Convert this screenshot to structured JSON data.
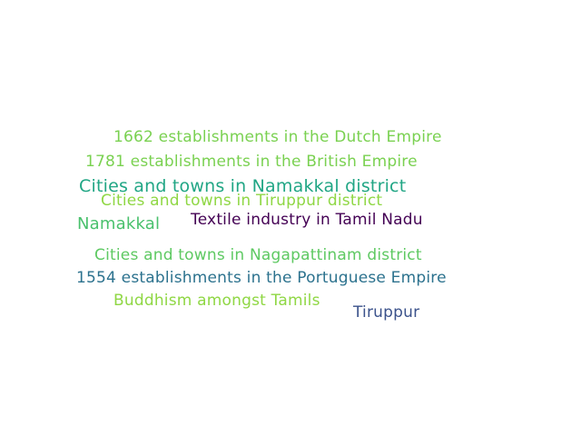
{
  "words": [
    {
      "text": "1662 establishments in the Dutch Empire",
      "color": "#7ad151"
    },
    {
      "text": "1781 establishments in the British Empire",
      "color": "#7ad151"
    },
    {
      "text": "Cities and towns in Namakkal district",
      "color": "#21a685"
    },
    {
      "text": "Cities and towns in Tiruppur district",
      "color": "#8fd744"
    },
    {
      "text": "Namakkal",
      "color": "#4ac16d"
    },
    {
      "text": "Textile industry in Tamil Nadu",
      "color": "#440154"
    },
    {
      "text": "Cities and towns in Nagapattinam district",
      "color": "#5ec962"
    },
    {
      "text": "1554 establishments in the Portuguese Empire",
      "color": "#2c728e"
    },
    {
      "text": "Buddhism amongst Tamils",
      "color": "#8fd744"
    },
    {
      "text": "Tiruppur",
      "color": "#3b528b"
    }
  ]
}
